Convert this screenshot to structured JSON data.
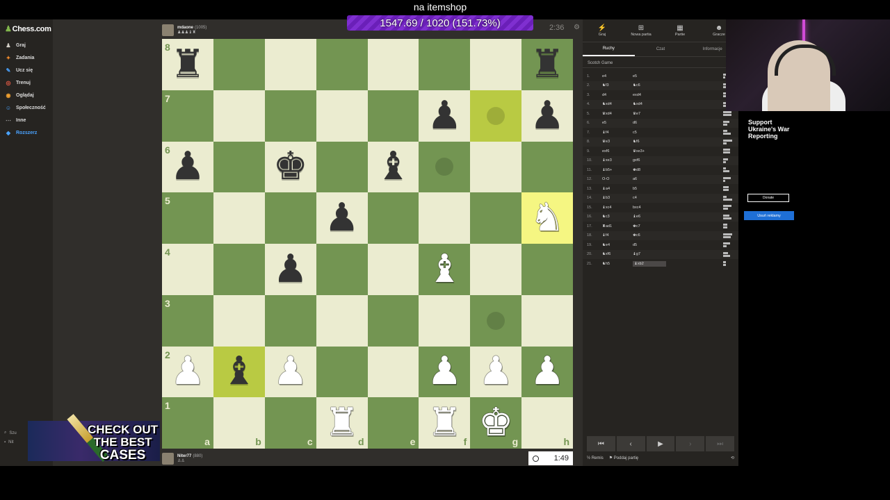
{
  "overlay": {
    "title": "na itemshop",
    "progress_text": "1547.69 / 1020 (151.73%)",
    "progress_fraction": 1.0,
    "progress_color": "#7f2fd0"
  },
  "sidebar": {
    "logo": "Chess.com",
    "items": [
      {
        "label": "Graj",
        "icon": "♟",
        "color": "#d4d0c8"
      },
      {
        "label": "Zadania",
        "icon": "✦",
        "color": "#f08a2c"
      },
      {
        "label": "Ucz się",
        "icon": "✎",
        "color": "#4aa3ff"
      },
      {
        "label": "Trenuj",
        "icon": "◎",
        "color": "#e65a45"
      },
      {
        "label": "Oglądaj",
        "icon": "◉",
        "color": "#f0a030"
      },
      {
        "label": "Społeczność",
        "icon": "☺",
        "color": "#4aa3ff"
      },
      {
        "label": "Inne",
        "icon": "⋯",
        "color": "#aaa"
      },
      {
        "label": "Rozszerz",
        "icon": "◆",
        "color": "#4aa3ff"
      }
    ],
    "bottom": [
      "Szu",
      "Nit"
    ]
  },
  "opponent": {
    "name": "mdaone",
    "rating": "(1005)",
    "material": "♟♟♟♝♜",
    "clock": "2:36"
  },
  "player": {
    "name": "Niter77",
    "rating": "(880)",
    "material": "♙♙",
    "clock": "1:49"
  },
  "board": {
    "light": "#ebecd0",
    "dark": "#739552",
    "ranks": [
      "8",
      "7",
      "6",
      "5",
      "4",
      "3",
      "2",
      "1"
    ],
    "files": [
      "a",
      "b",
      "c",
      "d",
      "e",
      "f",
      "g",
      "h"
    ],
    "squares": [
      [
        "br",
        "",
        "",
        "",
        "",
        "",
        "",
        "br"
      ],
      [
        "",
        "",
        "",
        "",
        "",
        "bp",
        "*",
        "bp"
      ],
      [
        "bp",
        "",
        "bk",
        "",
        "bb",
        "*",
        "",
        ""
      ],
      [
        "",
        "",
        "",
        "bp",
        "",
        "",
        "",
        "wn"
      ],
      [
        "",
        "",
        "bp",
        "",
        "",
        "wb",
        "",
        ""
      ],
      [
        "",
        "",
        "",
        "",
        "",
        "",
        "*",
        ""
      ],
      [
        "wp",
        "bb",
        "wp",
        "",
        "",
        "wp",
        "wp",
        "wp"
      ],
      [
        "",
        "",
        "",
        "wr",
        "",
        "wr",
        "wk",
        ""
      ]
    ],
    "highlights": [
      "g7",
      "h5",
      "b2"
    ]
  },
  "panel": {
    "tabs": [
      {
        "label": "Graj",
        "icon": "⚡"
      },
      {
        "label": "Nowa partia",
        "icon": "⊞"
      },
      {
        "label": "Partie",
        "icon": "▦"
      },
      {
        "label": "Gracze",
        "icon": "☻"
      }
    ],
    "subtabs": [
      "Ruchy",
      "Czat",
      "Informacje"
    ],
    "opening": "Scotch Game",
    "moves": [
      [
        "1.",
        "e4",
        "e5"
      ],
      [
        "2.",
        "♞f3",
        "♞c6"
      ],
      [
        "3.",
        "d4",
        "exd4"
      ],
      [
        "4.",
        "♞xd4",
        "♞xd4"
      ],
      [
        "5.",
        "♛xd4",
        "♛e7"
      ],
      [
        "6.",
        "e5",
        "d6"
      ],
      [
        "7.",
        "♝f4",
        "c5"
      ],
      [
        "8.",
        "♛e3",
        "♞f6"
      ],
      [
        "9.",
        "exf6",
        "♛xe3+"
      ],
      [
        "10.",
        "♝xe3",
        "gxf6"
      ],
      [
        "11.",
        "♝b5+",
        "♚d8"
      ],
      [
        "12.",
        "O-O",
        "a6"
      ],
      [
        "13.",
        "♝a4",
        "b5"
      ],
      [
        "14.",
        "♝b3",
        "c4"
      ],
      [
        "15.",
        "♝xc4",
        "bxc4"
      ],
      [
        "16.",
        "♞c3",
        "♝e6"
      ],
      [
        "17.",
        "♜ad1",
        "♚c7"
      ],
      [
        "18.",
        "♝f4",
        "♚c6"
      ],
      [
        "19.",
        "♞e4",
        "d5"
      ],
      [
        "20.",
        "♞xf6",
        "♝g7"
      ],
      [
        "21.",
        "♞h5",
        "♝xb2"
      ]
    ],
    "nav_buttons": [
      "⏮",
      "‹",
      "▶",
      "›",
      "⏭"
    ],
    "actions": {
      "draw": "Remis",
      "resign": "Poddaj partię",
      "draw_icon": "½",
      "resign_icon": "⚑"
    }
  },
  "ad": {
    "text": "Support Ukraine's War Reporting",
    "donate": "Donate",
    "remove_ads": "Usuń reklamy"
  },
  "promo": {
    "line1": "CHECK OUT",
    "line2": "THE BEST",
    "line3": "CASES"
  }
}
